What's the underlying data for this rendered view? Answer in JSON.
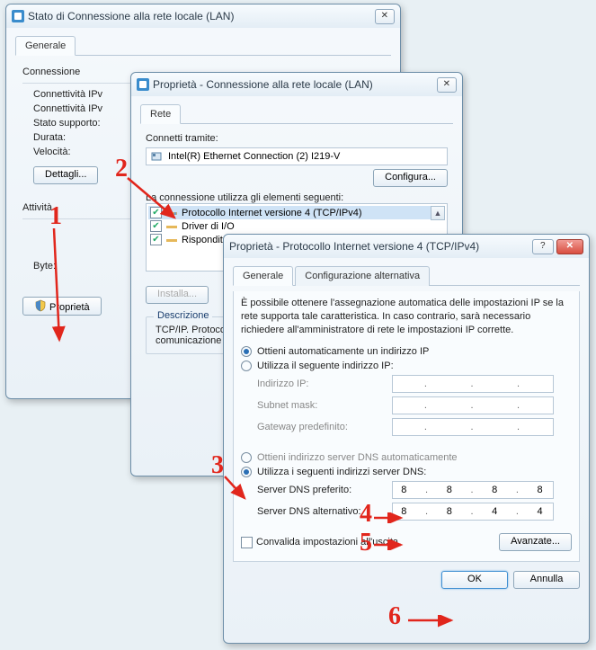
{
  "win1": {
    "title": "Stato di Connessione alla rete locale (LAN)",
    "tab_general": "Generale",
    "section_conn": "Connessione",
    "l_ipv4": "Connettività IPv",
    "l_ipv6": "Connettività IPv",
    "l_state": "Stato supporto:",
    "l_duration": "Durata:",
    "l_speed": "Velocità:",
    "btn_details": "Dettagli...",
    "section_activity": "Attività",
    "l_bytes": "Byte:",
    "btn_properties": "Proprietà"
  },
  "win2": {
    "title": "Proprietà - Connessione alla rete locale (LAN)",
    "tab_net": "Rete",
    "l_connect_via": "Connetti tramite:",
    "adapter": "Intel(R) Ethernet Connection (2) I219-V",
    "btn_configure": "Configura...",
    "l_uses": "La connessione utilizza gli elementi seguenti:",
    "items": [
      "Protocollo Internet versione 4 (TCP/IPv4)",
      "Driver di I/O",
      "Risponditore"
    ],
    "btn_install": "Installa...",
    "section_desc": "Descrizione",
    "desc_text": "TCP/IP. Protocollo\ncomunicazione tra"
  },
  "win3": {
    "title": "Proprietà - Protocollo Internet versione 4 (TCP/IPv4)",
    "tab_general": "Generale",
    "tab_altconf": "Configurazione alternativa",
    "intro": "È possibile ottenere l'assegnazione automatica delle impostazioni IP se la rete supporta tale caratteristica. In caso contrario, sarà necessario richiedere all'amministratore di rete le impostazioni IP corrette.",
    "r_auto_ip": "Ottieni automaticamente un indirizzo IP",
    "r_manual_ip": "Utilizza il seguente indirizzo IP:",
    "l_ip": "Indirizzo IP:",
    "l_mask": "Subnet mask:",
    "l_gw": "Gateway predefinito:",
    "r_auto_dns": "Ottieni indirizzo server DNS automaticamente",
    "r_manual_dns": "Utilizza i seguenti indirizzi server DNS:",
    "l_dns1": "Server DNS preferito:",
    "l_dns2": "Server DNS alternativo:",
    "dns1": [
      "8",
      "8",
      "8",
      "8"
    ],
    "dns2": [
      "8",
      "8",
      "4",
      "4"
    ],
    "chk_validate": "Convalida impostazioni all'uscita",
    "btn_advanced": "Avanzate...",
    "btn_ok": "OK",
    "btn_cancel": "Annulla"
  },
  "annotations": {
    "n1": "1",
    "n2": "2",
    "n3": "3",
    "n4": "4",
    "n5": "5",
    "n6": "6"
  }
}
